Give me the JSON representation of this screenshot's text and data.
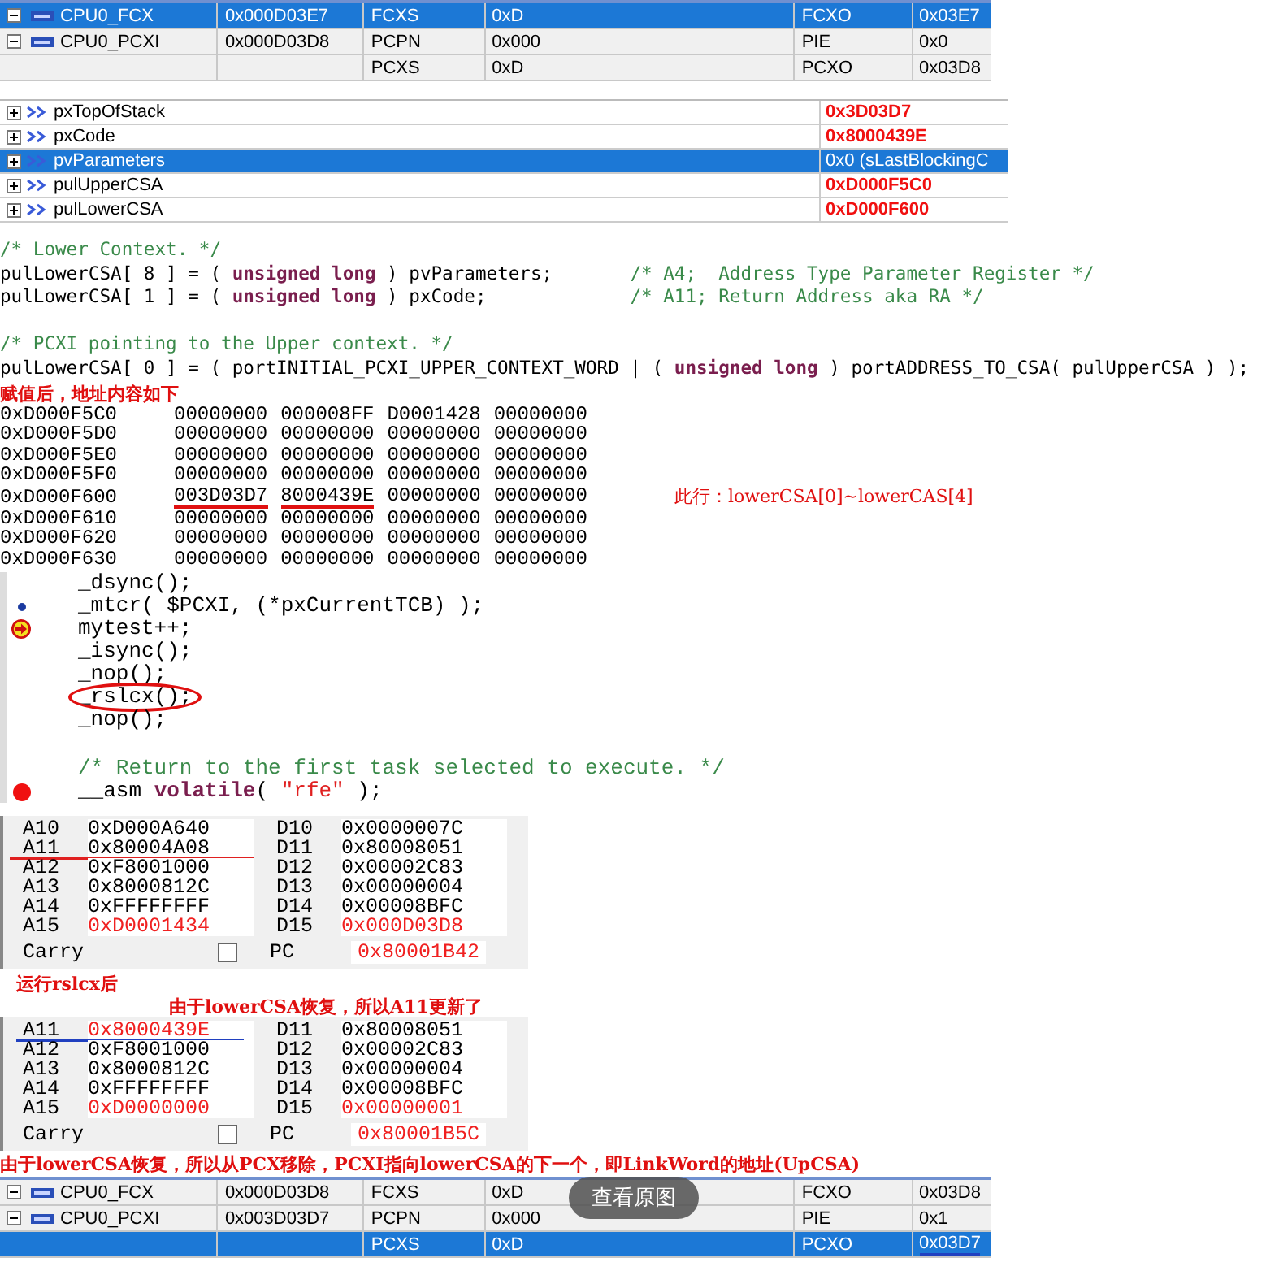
{
  "register_table_before": {
    "rows": [
      {
        "expanded": true,
        "name": "CPU0_FCX",
        "cells": [
          "0x000D03E7",
          "FCXS",
          "0xD",
          "FCXO",
          "0x03E7"
        ],
        "selected": true
      },
      {
        "expanded": true,
        "name": "CPU0_PCXI",
        "cells": [
          "0x000D03D8",
          "PCPN",
          "0x000",
          "PIE",
          "0x0"
        ],
        "selected": false
      },
      {
        "cells": [
          "",
          "PCXS",
          "0xD",
          "PCXO",
          "0x03D8"
        ],
        "selected": false
      }
    ]
  },
  "variables": [
    {
      "expanded": false,
      "name": "pxTopOfStack",
      "value": "0x3D03D7",
      "selected": false
    },
    {
      "expanded": false,
      "name": "pxCode",
      "value": "0x8000439E",
      "selected": false
    },
    {
      "expanded": false,
      "name": "pvParameters",
      "value": "0x0 (sLastBlockingC",
      "selected": true
    },
    {
      "expanded": false,
      "name": "pulUpperCSA",
      "value": "0xD000F5C0",
      "selected": false
    },
    {
      "expanded": false,
      "name": "pulLowerCSA",
      "value": "0xD000F600",
      "selected": false
    }
  ],
  "code_lines": [
    {
      "kind": "code",
      "segments": [
        {
          "kind": "comment",
          "text": "/* Lower Context. */"
        }
      ]
    },
    {
      "kind": "code",
      "segments": [
        {
          "kind": "plain",
          "text": "pulLowerCSA[ 8 ] = ( "
        },
        {
          "kind": "keyword",
          "text": "unsigned long"
        },
        {
          "kind": "plain",
          "text": " ) pvParameters;       "
        },
        {
          "kind": "comment",
          "text": "/* A4;  Address Type Parameter Register */"
        }
      ]
    },
    {
      "kind": "code",
      "segments": [
        {
          "kind": "plain",
          "text": "pulLowerCSA[ 1 ] = ( "
        },
        {
          "kind": "keyword",
          "text": "unsigned long"
        },
        {
          "kind": "plain",
          "text": " ) pxCode;             "
        },
        {
          "kind": "comment",
          "text": "/* A11; Return Address aka RA */"
        }
      ]
    },
    {
      "kind": "blank"
    },
    {
      "kind": "code",
      "segments": [
        {
          "kind": "comment",
          "text": "/* PCXI pointing to the Upper context. */"
        }
      ]
    },
    {
      "kind": "code",
      "segments": [
        {
          "kind": "plain",
          "text": "pulLowerCSA[ 0 ] = ( portINITIAL_PCXI_UPPER_CONTEXT_WORD | ( "
        },
        {
          "kind": "keyword",
          "text": "unsigned long"
        },
        {
          "kind": "plain",
          "text": " ) portADDRESS_TO_CSA( pulUpperCSA ) );"
        }
      ]
    }
  ],
  "memory_caption": "赋值后，地址内容如下",
  "memory_rows": [
    {
      "address": "0xD000F5C0",
      "words": [
        {
          "text": "00000000",
          "underlined": false
        },
        {
          "text": "000008FF",
          "underlined": false
        },
        {
          "text": "D0001428",
          "underlined": false
        },
        {
          "text": "00000000",
          "underlined": false
        }
      ]
    },
    {
      "address": "0xD000F5D0",
      "words": [
        {
          "text": "00000000",
          "underlined": false
        },
        {
          "text": "00000000",
          "underlined": false
        },
        {
          "text": "00000000",
          "underlined": false
        },
        {
          "text": "00000000",
          "underlined": false
        }
      ]
    },
    {
      "address": "0xD000F5E0",
      "words": [
        {
          "text": "00000000",
          "underlined": false
        },
        {
          "text": "00000000",
          "underlined": false
        },
        {
          "text": "00000000",
          "underlined": false
        },
        {
          "text": "00000000",
          "underlined": false
        }
      ]
    },
    {
      "address": "0xD000F5F0",
      "words": [
        {
          "text": "00000000",
          "underlined": false
        },
        {
          "text": "00000000",
          "underlined": false
        },
        {
          "text": "00000000",
          "underlined": false
        },
        {
          "text": "00000000",
          "underlined": false
        }
      ]
    },
    {
      "address": "0xD000F600",
      "words": [
        {
          "text": "003D03D7",
          "underlined": true
        },
        {
          "text": "8000439E",
          "underlined": true
        },
        {
          "text": "00000000",
          "underlined": false
        },
        {
          "text": "00000000",
          "underlined": false
        }
      ],
      "note": "此行：lowerCSA[0]~lowerCAS[4]"
    },
    {
      "address": "0xD000F610",
      "words": [
        {
          "text": "00000000",
          "underlined": false
        },
        {
          "text": "00000000",
          "underlined": false
        },
        {
          "text": "00000000",
          "underlined": false
        },
        {
          "text": "00000000",
          "underlined": false
        }
      ]
    },
    {
      "address": "0xD000F620",
      "words": [
        {
          "text": "00000000",
          "underlined": false
        },
        {
          "text": "00000000",
          "underlined": false
        },
        {
          "text": "00000000",
          "underlined": false
        },
        {
          "text": "00000000",
          "underlined": false
        }
      ]
    },
    {
      "address": "0xD000F630",
      "words": [
        {
          "text": "00000000",
          "underlined": false
        },
        {
          "text": "00000000",
          "underlined": false
        },
        {
          "text": "00000000",
          "underlined": false
        },
        {
          "text": "00000000",
          "underlined": false
        }
      ]
    }
  ],
  "source_lines": [
    {
      "kind": "plain",
      "circled": false,
      "segments": [
        {
          "kind": "plain",
          "text": "_dsync();"
        }
      ]
    },
    {
      "kind": "bookmarked",
      "circled": false,
      "segments": [
        {
          "kind": "plain",
          "text": "_mtcr( $PCXI, (*pxCurrentTCB) );"
        }
      ]
    },
    {
      "kind": "current",
      "circled": false,
      "segments": [
        {
          "kind": "plain",
          "text": "mytest++;"
        }
      ]
    },
    {
      "kind": "plain",
      "circled": false,
      "segments": [
        {
          "kind": "plain",
          "text": "_isync();"
        }
      ]
    },
    {
      "kind": "plain",
      "circled": false,
      "segments": [
        {
          "kind": "plain",
          "text": "_nop();"
        }
      ]
    },
    {
      "kind": "plain",
      "circled": true,
      "segments": [
        {
          "kind": "plain",
          "text": "_rslcx();"
        }
      ]
    },
    {
      "kind": "plain",
      "circled": false,
      "segments": [
        {
          "kind": "plain",
          "text": "_nop();"
        }
      ]
    },
    {
      "kind": "blank"
    },
    {
      "kind": "plain",
      "circled": false,
      "segments": [
        {
          "kind": "comment",
          "text": "/* Return to the first task selected to execute. */"
        }
      ]
    },
    {
      "kind": "breakpoint",
      "circled": false,
      "segments": [
        {
          "kind": "plain",
          "text": "__asm "
        },
        {
          "kind": "keyword",
          "text": "volatile"
        },
        {
          "kind": "plain",
          "text": "( "
        },
        {
          "kind": "string",
          "text": "\"rfe\""
        },
        {
          "kind": "plain",
          "text": " );"
        }
      ]
    }
  ],
  "register_panels": [
    {
      "color": "#e02020",
      "rows": [
        {
          "a_name": "A10",
          "a_value": "0xD000A640",
          "a_changed": false,
          "d_name": "D10",
          "d_value": "0x0000007C",
          "d_changed": false,
          "underlined": false
        },
        {
          "a_name": "A11",
          "a_value": "0x80004A08",
          "a_changed": false,
          "d_name": "D11",
          "d_value": "0x80008051",
          "d_changed": false,
          "underlined": true
        },
        {
          "a_name": "A12",
          "a_value": "0xF8001000",
          "a_changed": false,
          "d_name": "D12",
          "d_value": "0x00002C83",
          "d_changed": false,
          "underlined": false
        },
        {
          "a_name": "A13",
          "a_value": "0x8000812C",
          "a_changed": false,
          "d_name": "D13",
          "d_value": "0x00000004",
          "d_changed": false,
          "underlined": false
        },
        {
          "a_name": "A14",
          "a_value": "0xFFFFFFFF",
          "a_changed": false,
          "d_name": "D14",
          "d_value": "0x00008BFC",
          "d_changed": false,
          "underlined": false
        },
        {
          "a_name": "A15",
          "a_value": "0xD0001434",
          "a_changed": true,
          "d_name": "D15",
          "d_value": "0x000D03D8",
          "d_changed": true,
          "underlined": false
        }
      ],
      "carry_label": "Carry",
      "carry_checked": false,
      "pc_label": "PC",
      "pc_value": "0x80001B42"
    },
    {
      "captions": [
        "运行rslcx后",
        "由于lowerCSA恢复，所以A11更新了"
      ],
      "color": "#2040c0",
      "rows": [
        {
          "a_name": "A11",
          "a_value": "0x8000439E",
          "a_changed": true,
          "d_name": "D11",
          "d_value": "0x80008051",
          "d_changed": false,
          "underlined": true
        },
        {
          "a_name": "A12",
          "a_value": "0xF8001000",
          "a_changed": false,
          "d_name": "D12",
          "d_value": "0x00002C83",
          "d_changed": false,
          "underlined": false
        },
        {
          "a_name": "A13",
          "a_value": "0x8000812C",
          "a_changed": false,
          "d_name": "D13",
          "d_value": "0x00000004",
          "d_changed": false,
          "underlined": false
        },
        {
          "a_name": "A14",
          "a_value": "0xFFFFFFFF",
          "a_changed": false,
          "d_name": "D14",
          "d_value": "0x00008BFC",
          "d_changed": false,
          "underlined": false
        },
        {
          "a_name": "A15",
          "a_value": "0xD0000000",
          "a_changed": true,
          "d_name": "D15",
          "d_value": "0x00000001",
          "d_changed": true,
          "underlined": false
        }
      ],
      "carry_label": "Carry",
      "carry_checked": false,
      "pc_label": "PC",
      "pc_value": "0x80001B5C"
    }
  ],
  "after_note": "由于lowerCSA恢复，所以从PCX移除，PCXI指向lowerCSA的下一个，即LinkWord的地址(UpCSA)",
  "register_table_after": {
    "rows": [
      {
        "expanded": true,
        "name": "CPU0_FCX",
        "cells": [
          "0x000D03D8",
          "FCXS",
          "0xD",
          "FCXO",
          "0x03D8"
        ],
        "selected": false
      },
      {
        "expanded": true,
        "name": "CPU0_PCXI",
        "cells": [
          "0x003D03D7",
          "PCPN",
          "0x000",
          "PIE",
          "0x1"
        ],
        "selected": false
      },
      {
        "cells": [
          "",
          "PCXS",
          "0xD",
          "PCXO",
          "0x03D7"
        ],
        "selected": true,
        "underline_last": true
      }
    ]
  },
  "view_original_button": "查看原图"
}
